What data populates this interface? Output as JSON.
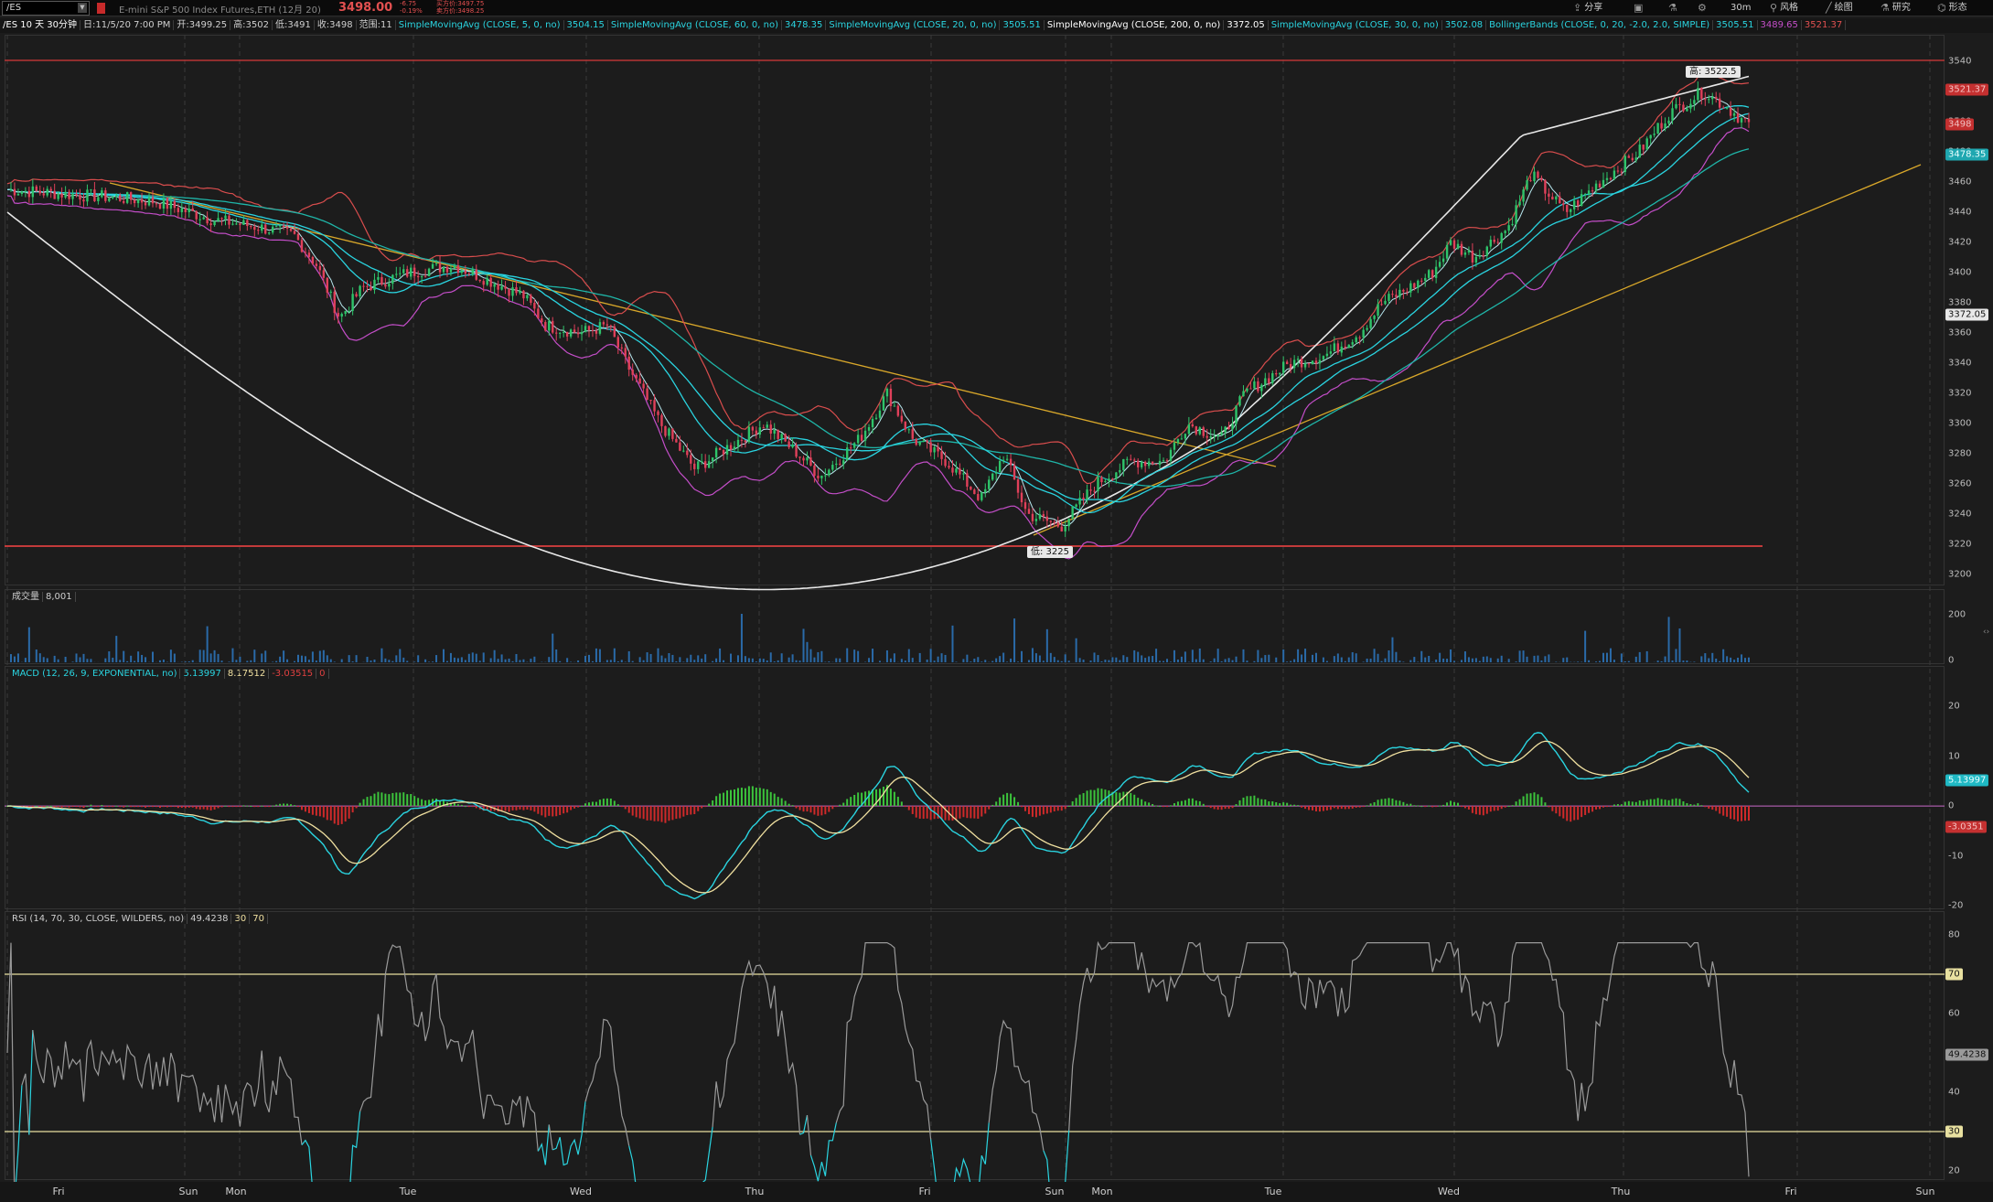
{
  "toolbar": {
    "symbol": "/ES",
    "description": "E-mini S&P 500 Index Futures,ETH (12月 20)",
    "last": "3498.00",
    "change": "-6.75",
    "change_pct": "-0.19%",
    "bid": "买方价:3497.75",
    "ask": "卖方价:3498.25",
    "share": "分享",
    "timeframe": "30m",
    "style": "风格",
    "draw": "绘图",
    "studies": "研究",
    "patterns": "形态"
  },
  "info": {
    "chart_period": "/ES 10 天 30分钟",
    "date": "日:11/5/20 7:00 PM",
    "open": "开:3499.25",
    "high": "高:3502",
    "low": "低:3491",
    "close": "收:3498",
    "range": "范围:11",
    "sma5": "SimpleMovingAvg (CLOSE, 5, 0, no)",
    "sma5_val": "3504.15",
    "sma60": "SimpleMovingAvg (CLOSE, 60, 0, no)",
    "sma60_val": "3478.35",
    "sma20": "SimpleMovingAvg (CLOSE, 20, 0, no)",
    "sma20_val": "3505.51",
    "sma200": "SimpleMovingAvg (CLOSE, 200, 0, no)",
    "sma200_val": "3372.05",
    "sma30": "SimpleMovingAvg (CLOSE, 30, 0, no)",
    "sma30_val": "3502.08",
    "bb": "BollingerBands (CLOSE, 0, 20, -2.0, 2.0, SIMPLE)",
    "bb_mid": "3505.51",
    "bb_low": "3489.65",
    "bb_up": "3521.37"
  },
  "price_pane": {
    "ticks": [
      "3540",
      "3520",
      "3500",
      "3480",
      "3460",
      "3440",
      "3420",
      "3400",
      "3380",
      "3360",
      "3340",
      "3320",
      "3300",
      "3280",
      "3260",
      "3240",
      "3220",
      "3200"
    ],
    "high_label": "高: 3522.5",
    "low_label": "低: 3225",
    "tag_bbup": "3521.37",
    "tag_last": "3498",
    "tag_sma60": "3478.35",
    "tag_sma200": "3372.05"
  },
  "volume_pane": {
    "label": "成交量",
    "value": "8,001",
    "ticks": [
      "200",
      "0"
    ]
  },
  "macd_pane": {
    "label": "MACD (12, 26, 9, EXPONENTIAL, no)",
    "value": "5.13997",
    "avg": "8.17512",
    "diff": "-3.03515",
    "zero": "0",
    "ticks": [
      "20",
      "10",
      "0",
      "-10",
      "-20"
    ],
    "tag_value": "5.13997",
    "tag_diff": "-3.0351"
  },
  "rsi_pane": {
    "label": "RSI (14, 70, 30, CLOSE, WILDERS, no)",
    "value": "49.4238",
    "ob": "30",
    "os": "70",
    "ticks": [
      "80",
      "60",
      "40",
      "20"
    ],
    "tag_ob": "70",
    "tag_os": "30",
    "tag_value": "49.4238"
  },
  "xaxis": [
    "Fri",
    "Sun",
    "Mon",
    "Tue",
    "Wed",
    "Thu",
    "Fri",
    "Sun",
    "Mon",
    "Tue",
    "Wed",
    "Thu",
    "Fri",
    "Sun"
  ],
  "colors": {
    "up": "#2ec46a",
    "down": "#e0405a",
    "sma_cyan": "#2ad4e0",
    "sma_teal": "#1fb5a8",
    "sma200": "#e8e8e8",
    "bb_upper": "#d94d4d",
    "bb_lower": "#c44ec9",
    "trend": "#d8a72a",
    "macd": "#2ad4e0",
    "signal": "#f0e0a0",
    "rsi": "#9a9a9a"
  }
}
